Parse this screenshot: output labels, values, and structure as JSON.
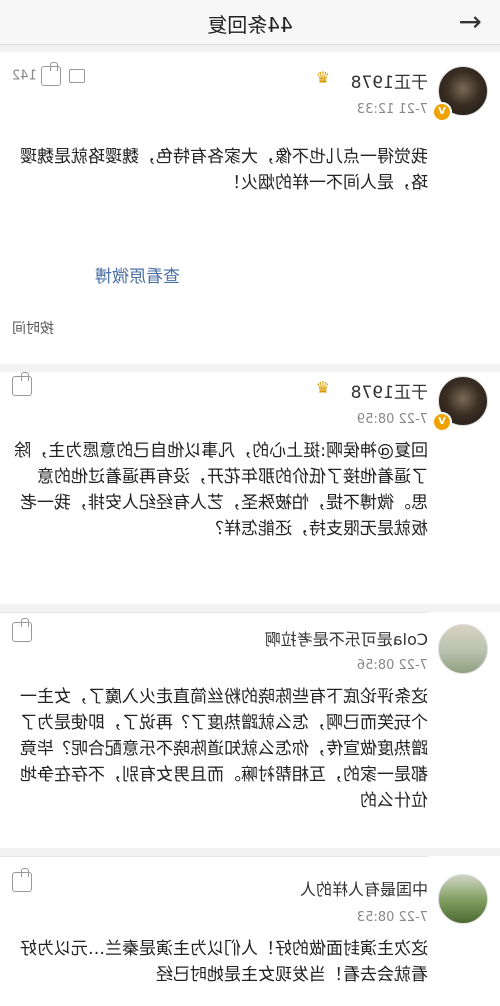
{
  "header": {
    "title": "44条回复",
    "back_icon": "arrow-icon"
  },
  "comments": [
    {
      "username": "于正1978",
      "time": "7-21 12:33",
      "likes": "142",
      "text": "我觉得一点儿也不像，大家各有特色，魏璎珞就是魏璎珞，是人间不一样的烟火！",
      "link": "查看原微博",
      "verified": true
    },
    {
      "username": "于正1978",
      "time": "7-22 08:59",
      "likes": "",
      "text": "回复@神侯啊:挺上心的，凡事以他自己的意愿为主，除了逼着他接了低价的那年花开，没有再逼着过他的意思。微博不提，怕被殊圣，艺人有经纪人安排，我一老板就是无限支持，还能怎样？",
      "verified": true
    },
    {
      "username": "Cola是可乐不是考拉啊",
      "time": "7-22 08:56",
      "likes": "",
      "text": "这条评论底下有些陈晓的粉丝简直走火入魔了，女主一个玩笑而已啊，怎么就蹭热度了？再说了，即使是为了蹭热度做宣传，你怎么就知道陈晓不乐意配合呢？毕竟都是一家的，互相帮衬嘛。而且男女有别，不存在争地位什么的"
    },
    {
      "username": "中国最有人样的人",
      "time": "7-22 08:53",
      "likes": "",
      "text": "这次主演封面做的好！人们以为主演是秦兰…元以为好看就会去看！当发现女主是她时已经"
    }
  ],
  "sort_label": "按时间"
}
